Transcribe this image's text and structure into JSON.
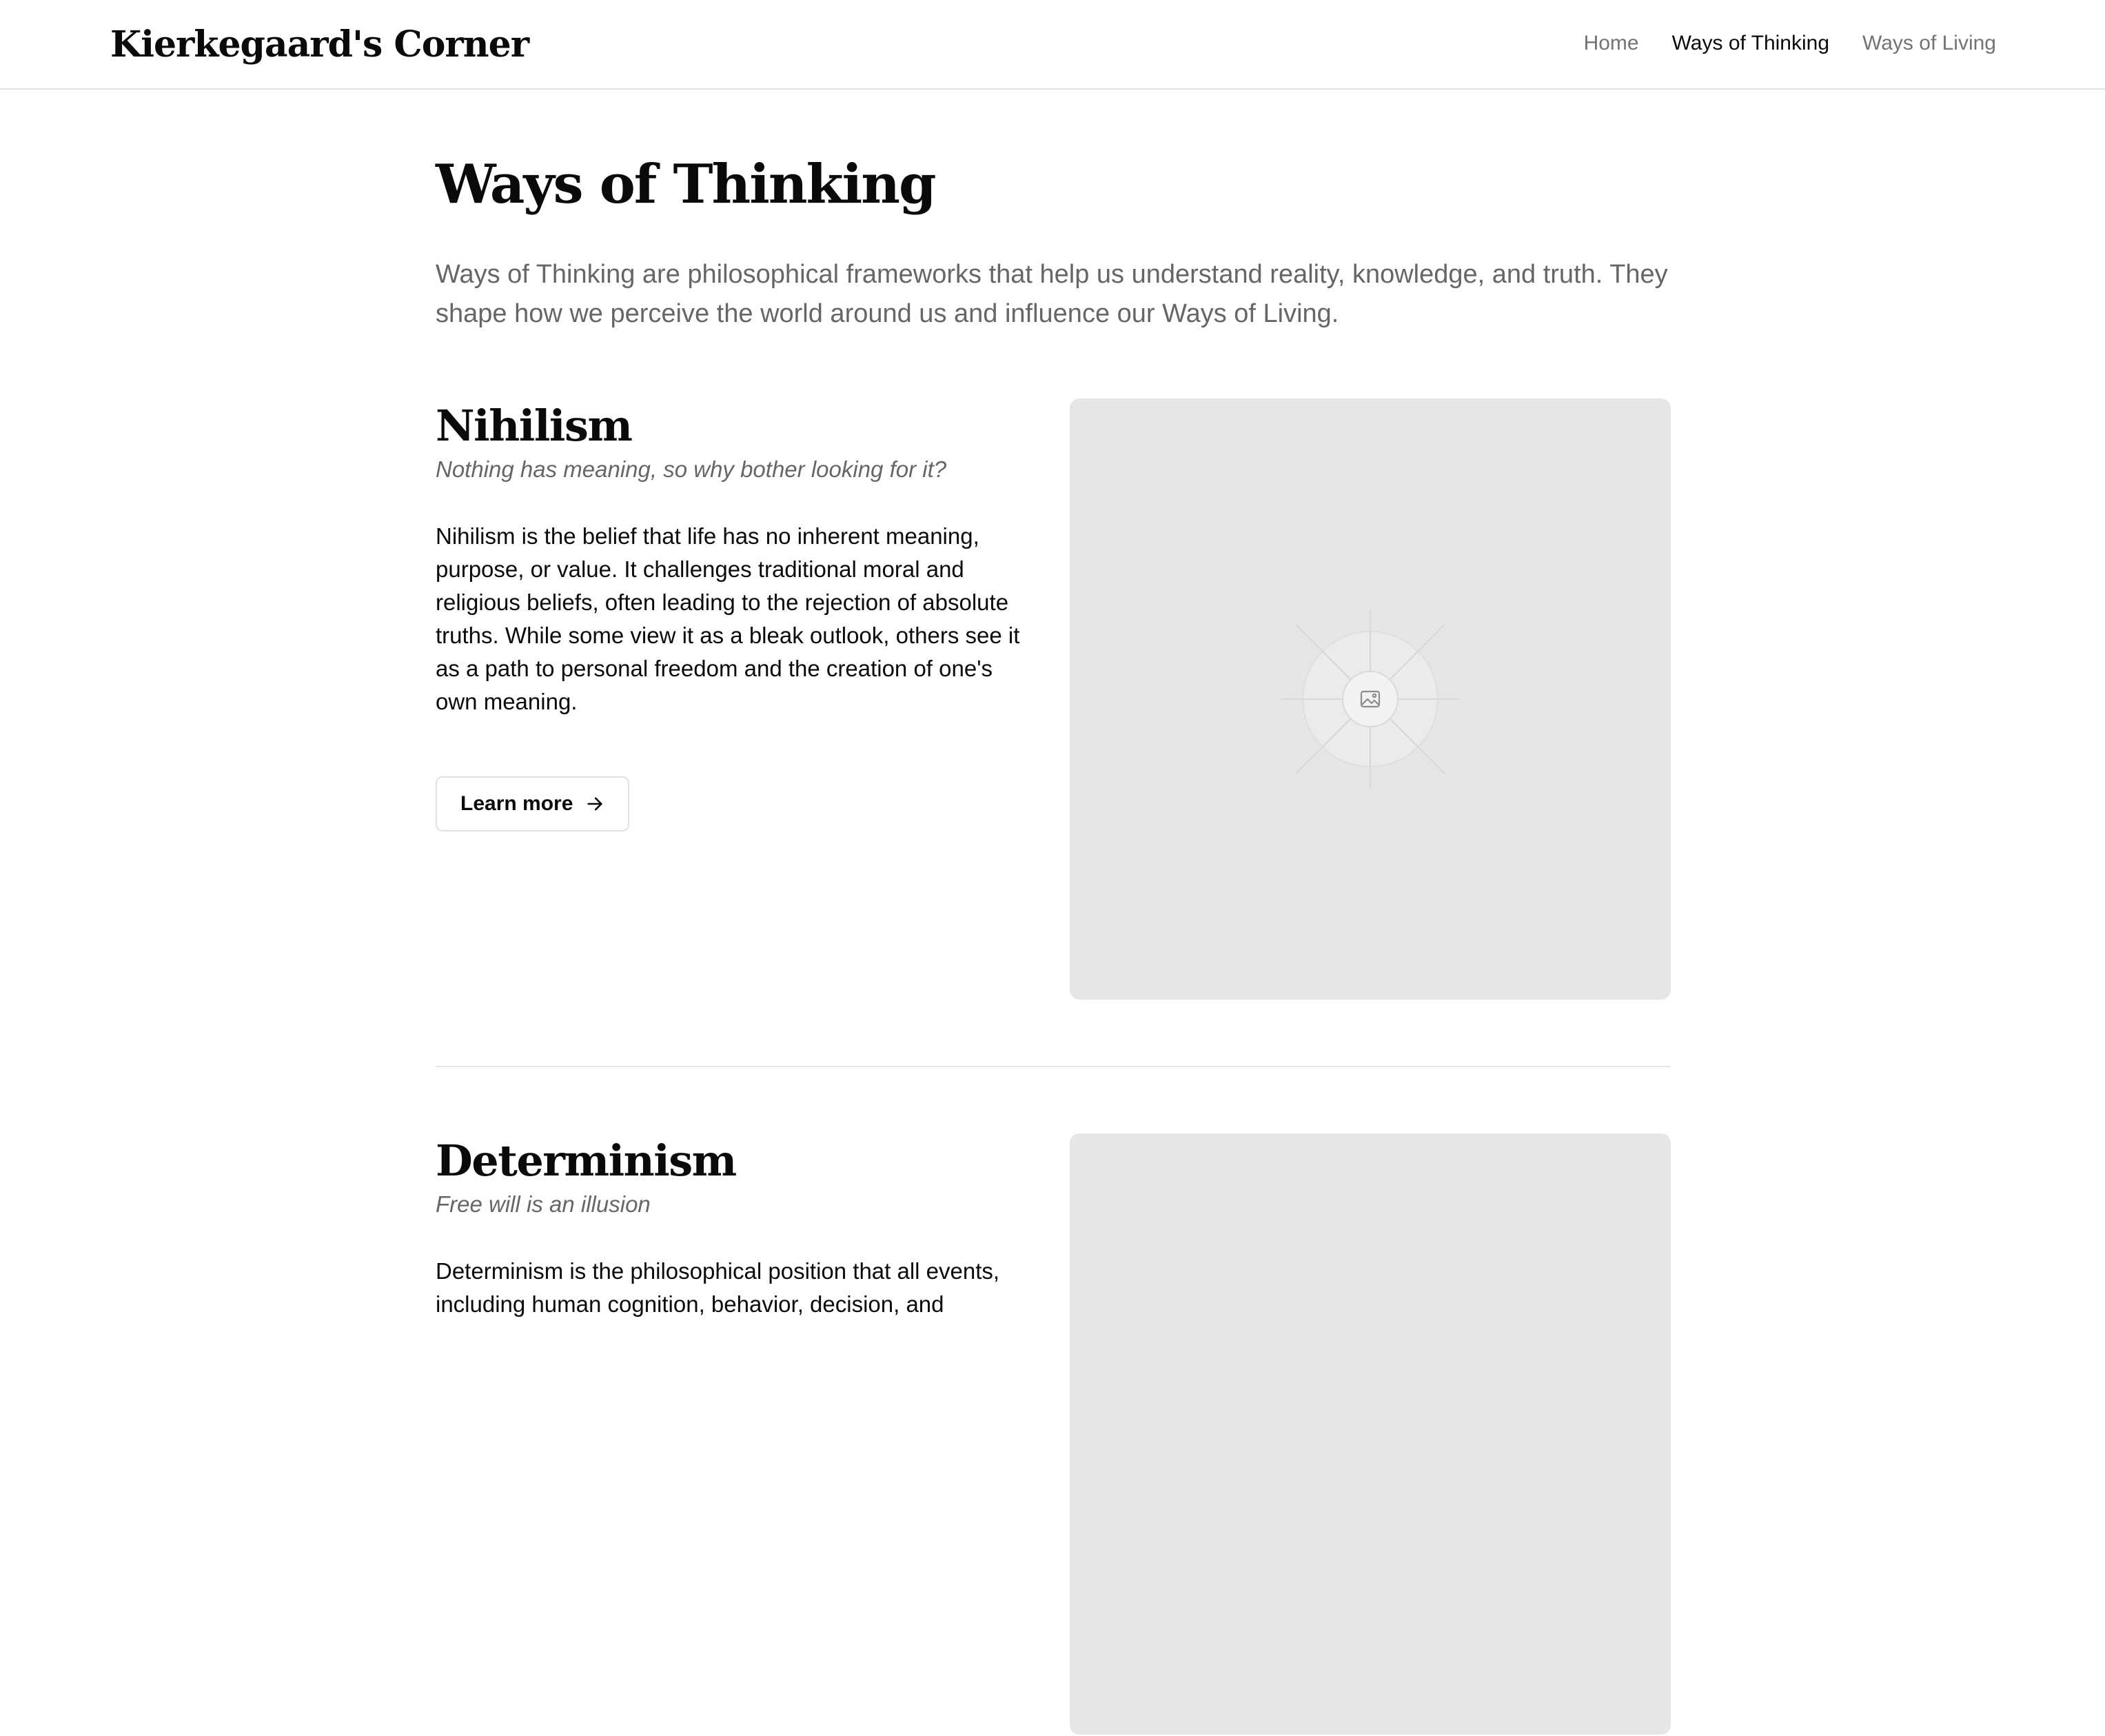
{
  "header": {
    "brand": "Kierkegaard's Corner",
    "nav": [
      {
        "label": "Home",
        "active": false
      },
      {
        "label": "Ways of Thinking",
        "active": true
      },
      {
        "label": "Ways of Living",
        "active": false
      }
    ]
  },
  "main": {
    "title": "Ways of Thinking",
    "intro": "Ways of Thinking are philosophical frameworks that help us understand reality, knowledge, and truth. They shape how we perceive the world around us and influence our Ways of Living.",
    "sections": [
      {
        "title": "Nihilism",
        "tagline": "Nothing has meaning, so why bother looking for it?",
        "body": "Nihilism is the belief that life has no inherent meaning, purpose, or value. It challenges traditional moral and religious beliefs, often leading to the rejection of absolute truths. While some view it as a bleak outlook, others see it as a path to personal freedom and the creation of one's own meaning.",
        "button_label": "Learn more",
        "image_icon": "image-icon"
      },
      {
        "title": "Determinism",
        "tagline": "Free will is an illusion",
        "body": "Determinism is the philosophical position that all events, including human cognition, behavior, decision, and"
      }
    ]
  },
  "colors": {
    "text": "#0a0a0a",
    "muted": "#666666",
    "placeholder_bg": "#e6e6e6",
    "border": "#e5e5e5"
  }
}
